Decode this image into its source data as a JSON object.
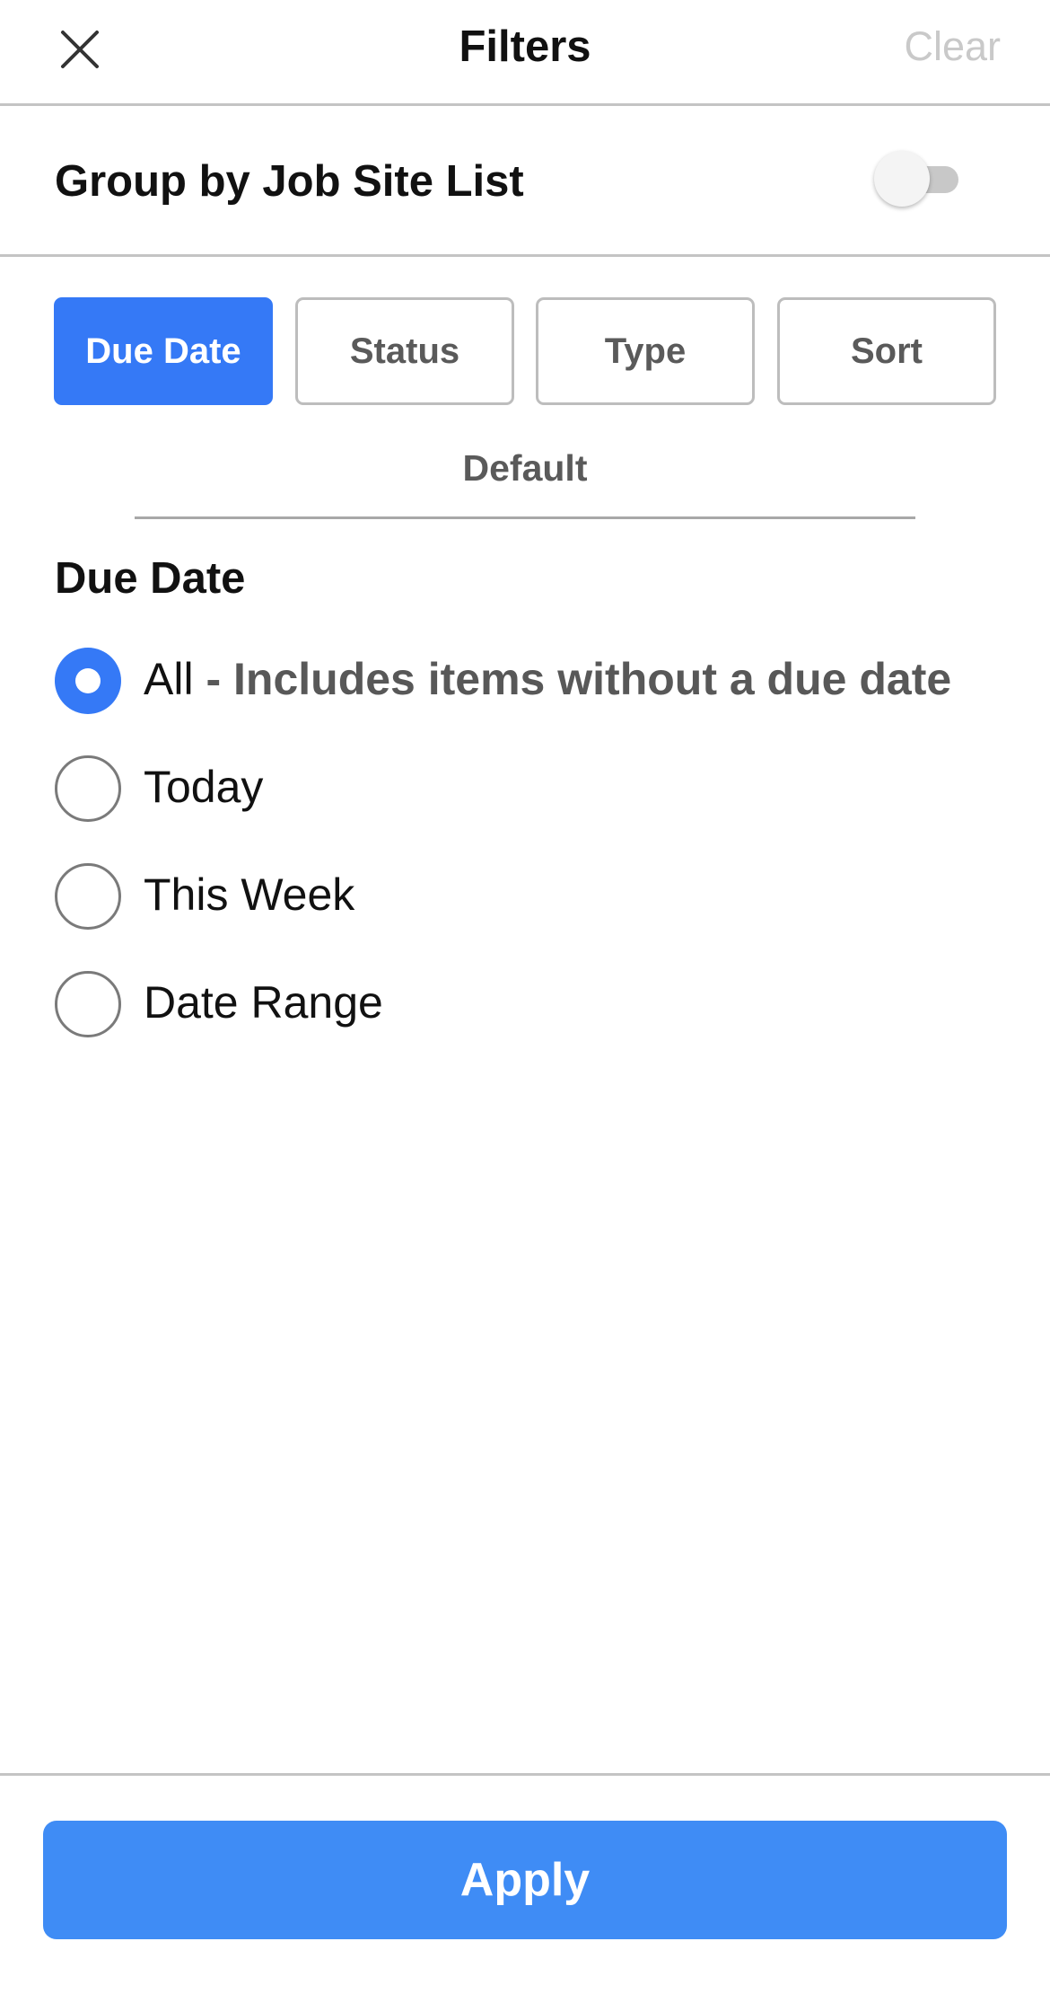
{
  "header": {
    "title": "Filters",
    "clear_label": "Clear"
  },
  "group_by": {
    "label": "Group by Job Site List",
    "enabled": false
  },
  "tabs": [
    {
      "label": "Due Date",
      "active": true
    },
    {
      "label": "Status",
      "active": false
    },
    {
      "label": "Type",
      "active": false
    },
    {
      "label": "Sort",
      "active": false
    }
  ],
  "subtab": {
    "label": "Default"
  },
  "due_date": {
    "title": "Due Date",
    "options": [
      {
        "label": "All",
        "description": "- Includes items without a due date",
        "selected": true
      },
      {
        "label": "Today",
        "selected": false
      },
      {
        "label": "This Week",
        "selected": false
      },
      {
        "label": "Date Range",
        "selected": false
      }
    ]
  },
  "footer": {
    "apply_label": "Apply"
  },
  "colors": {
    "accent": "#3579f6",
    "apply": "#3f8cf5",
    "divider": "#c4c4c4",
    "muted_text": "#5a5a5a",
    "disabled_text": "#c9c9c9"
  },
  "icons": {
    "close": "close-icon"
  }
}
